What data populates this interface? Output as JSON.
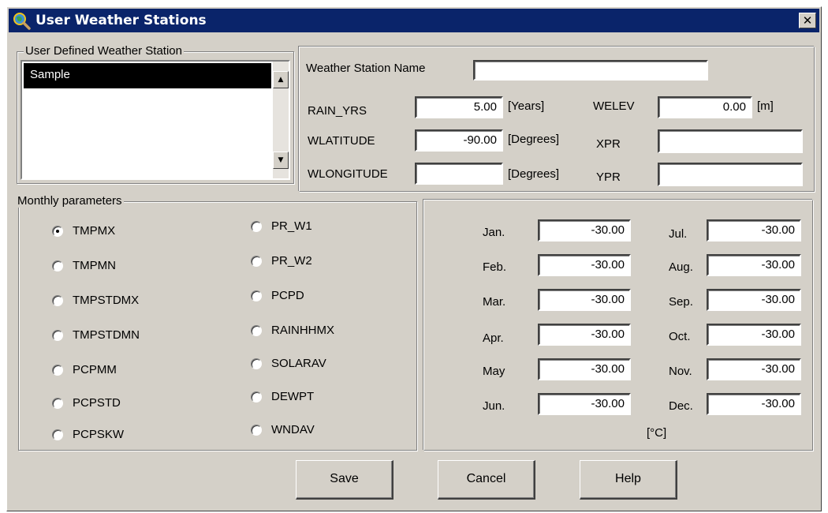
{
  "window": {
    "title": "User Weather Stations",
    "close_glyph": "✕",
    "colors": {
      "face": "#d4d0c8",
      "titlebar": "#0a246a",
      "selection": "#000000"
    }
  },
  "station_list": {
    "group_label": "User Defined Weather Station",
    "items": [
      "Sample"
    ],
    "selected": "Sample"
  },
  "station_info": {
    "name_label": "Weather Station Name",
    "name_value": "",
    "rain_yrs": {
      "label": "RAIN_YRS",
      "value": "5.00",
      "unit": "[Years]"
    },
    "wlatitude": {
      "label": "WLATITUDE",
      "value": "-90.00",
      "unit": "[Degrees]"
    },
    "wlongitude": {
      "label": "WLONGITUDE",
      "value": "",
      "unit": "[Degrees]"
    },
    "welev": {
      "label": "WELEV",
      "value": "0.00",
      "unit": "[m]"
    },
    "xpr": {
      "label": "XPR",
      "value": ""
    },
    "ypr": {
      "label": "YPR",
      "value": ""
    }
  },
  "monthly": {
    "group_label": "Monthly parameters",
    "selected": "TMPMX",
    "params": [
      "TMPMX",
      "TMPMN",
      "TMPSTDMX",
      "TMPSTDMN",
      "PCPMM",
      "PCPSTD",
      "PCPSKW",
      "PR_W1",
      "PR_W2",
      "PCPD",
      "RAINHHMX",
      "SOLARAV",
      "DEWPT",
      "WNDAV"
    ],
    "months": [
      {
        "label": "Jan.",
        "value": "-30.00"
      },
      {
        "label": "Feb.",
        "value": "-30.00"
      },
      {
        "label": "Mar.",
        "value": "-30.00"
      },
      {
        "label": "Apr.",
        "value": "-30.00"
      },
      {
        "label": "May",
        "value": "-30.00"
      },
      {
        "label": "Jun.",
        "value": "-30.00"
      },
      {
        "label": "Jul.",
        "value": "-30.00"
      },
      {
        "label": "Aug.",
        "value": "-30.00"
      },
      {
        "label": "Sep.",
        "value": "-30.00"
      },
      {
        "label": "Oct.",
        "value": "-30.00"
      },
      {
        "label": "Nov.",
        "value": "-30.00"
      },
      {
        "label": "Dec.",
        "value": "-30.00"
      }
    ],
    "unit": "[°C]"
  },
  "buttons": {
    "save": "Save",
    "cancel": "Cancel",
    "help": "Help"
  },
  "icons": {
    "app": "globe-magnifier-icon",
    "close": "close-icon",
    "scroll_up": "arrow-up-icon",
    "scroll_down": "arrow-down-icon"
  }
}
